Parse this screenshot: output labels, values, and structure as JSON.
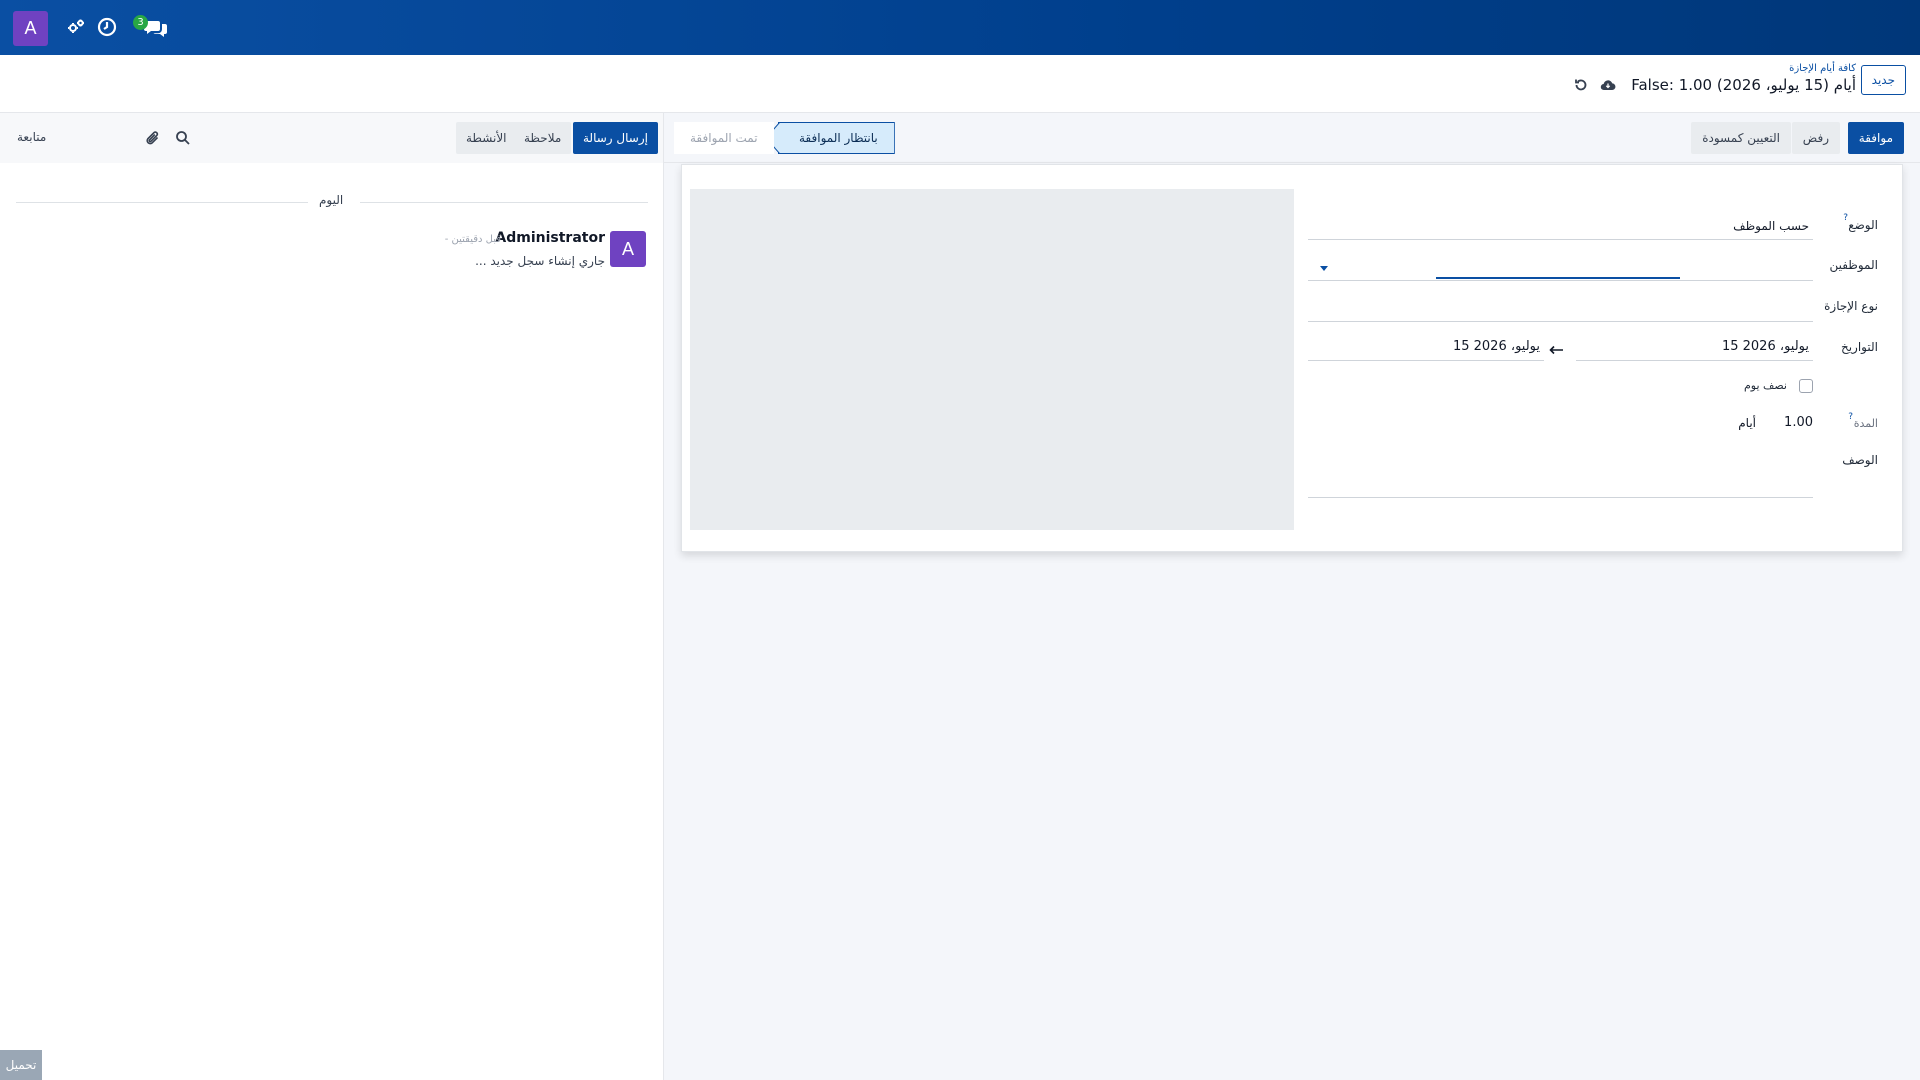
{
  "navbar": {
    "user_initial": "A",
    "messages_badge": "3",
    "icons": [
      "settings-icon",
      "clock-icon",
      "chat-icon"
    ]
  },
  "control_panel": {
    "new_button": "جديد",
    "breadcrumb_parent": "كافة أيام الإجازة",
    "breadcrumb_current": "False: 1.00 أيام (15 يوليو، 2026)",
    "icons": [
      "cloud-save-icon",
      "discard-icon"
    ]
  },
  "statusbar": {
    "approve": "موافقة",
    "refuse": "رفض",
    "reset_draft": "التعيين كمسودة",
    "stage_active": "بانتظار الموافقة",
    "stage_next": "تمت الموافقة"
  },
  "form": {
    "mode_label": "الوضع",
    "mode_value": "حسب الموظف",
    "employees_label": "الموظفين",
    "leave_type_label": "نوع الإجازة",
    "dates_label": "التواريخ",
    "date_from": "15 يوليو، 2026",
    "date_to": "15 يوليو، 2026",
    "half_day_label": "نصف يوم",
    "duration_label": "المدة",
    "duration_value": "1.00",
    "duration_unit": "أيام",
    "description_label": "الوصف",
    "help_mark": "?"
  },
  "chatter": {
    "send_message": "إرسال رسالة",
    "log_note": "ملاحظة",
    "activities": "الأنشطة",
    "follow": "متابعة",
    "day_separator": "اليوم",
    "message": {
      "author_initial": "A",
      "author": "Administrator",
      "time": "- قبل دقيقتين",
      "body": "جاري إنشاء سجل جديد ..."
    }
  },
  "footer": {
    "upload": "تحميل"
  },
  "colors": {
    "primary": "#0a4fa3",
    "avatar": "#6f42c1",
    "badge": "#28a745"
  }
}
